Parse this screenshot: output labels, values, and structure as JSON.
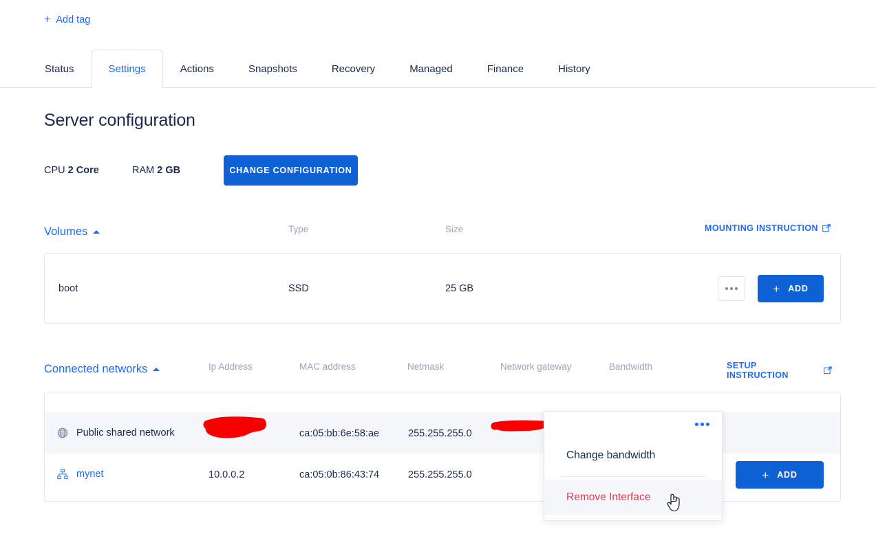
{
  "header": {
    "add_tag_label": "Add tag",
    "add_tag_icon": "plus-icon"
  },
  "tabs": [
    {
      "label": "Status",
      "active": false
    },
    {
      "label": "Settings",
      "active": true
    },
    {
      "label": "Actions",
      "active": false
    },
    {
      "label": "Snapshots",
      "active": false
    },
    {
      "label": "Recovery",
      "active": false
    },
    {
      "label": "Managed",
      "active": false
    },
    {
      "label": "Finance",
      "active": false
    },
    {
      "label": "History",
      "active": false
    }
  ],
  "main": {
    "title": "Server configuration",
    "specs": {
      "cpu_label": "CPU",
      "cpu_value": "2 Core",
      "ram_label": "RAM",
      "ram_value": "2 GB"
    },
    "change_configuration_label": "CHANGE CONFIGURATION"
  },
  "volumes": {
    "section_title": "Volumes",
    "collapse_icon": "caret-up-icon",
    "columns": [
      "Type",
      "Size"
    ],
    "instruction_link": "MOUNTING INSTRUCTION",
    "instruction_icon": "external-link-icon",
    "rows": [
      {
        "name": "boot",
        "type": "SSD",
        "size": "25 GB"
      }
    ],
    "more_icon": "ellipsis-icon",
    "add_label": "ADD",
    "add_icon": "plus-icon"
  },
  "networks": {
    "section_title": "Connected networks",
    "collapse_icon": "caret-up-icon",
    "columns": [
      "Ip Address",
      "MAC address",
      "Netmask",
      "Network gateway",
      "Bandwidth"
    ],
    "instruction_link": "SETUP INSTRUCTION",
    "instruction_icon": "external-link-icon",
    "rows": [
      {
        "name": "Public shared network",
        "icon": "globe-icon",
        "ip": "",
        "mac": "ca:05:bb:6e:58:ae",
        "netmask": "255.255.255.0",
        "gateway": "",
        "redacted_ip": true,
        "redacted_gateway": true
      },
      {
        "name": "mynet",
        "icon": "network-tree-icon",
        "ip": "10.0.0.2",
        "mac": "ca:05:0b:86:43:74",
        "netmask": "255.255.255.0",
        "gateway": "",
        "redacted_ip": false,
        "redacted_gateway": false
      }
    ],
    "add_label": "ADD",
    "add_icon": "plus-icon"
  },
  "context_menu": {
    "more_icon": "ellipsis-icon",
    "items": [
      {
        "label": "Change bandwidth",
        "danger": false,
        "hovered": false
      },
      {
        "label": "Remove Interface",
        "danger": true,
        "hovered": true
      }
    ]
  },
  "colors": {
    "accent_blue": "#1a6aff",
    "button_blue": "#0f62d6",
    "danger_red": "#e8384f",
    "text_dark": "#1b2a4e",
    "muted": "#9aa6bd",
    "redaction": "#fb0000",
    "row_highlight": "#f5f7fa",
    "border": "#e3e7ee"
  }
}
